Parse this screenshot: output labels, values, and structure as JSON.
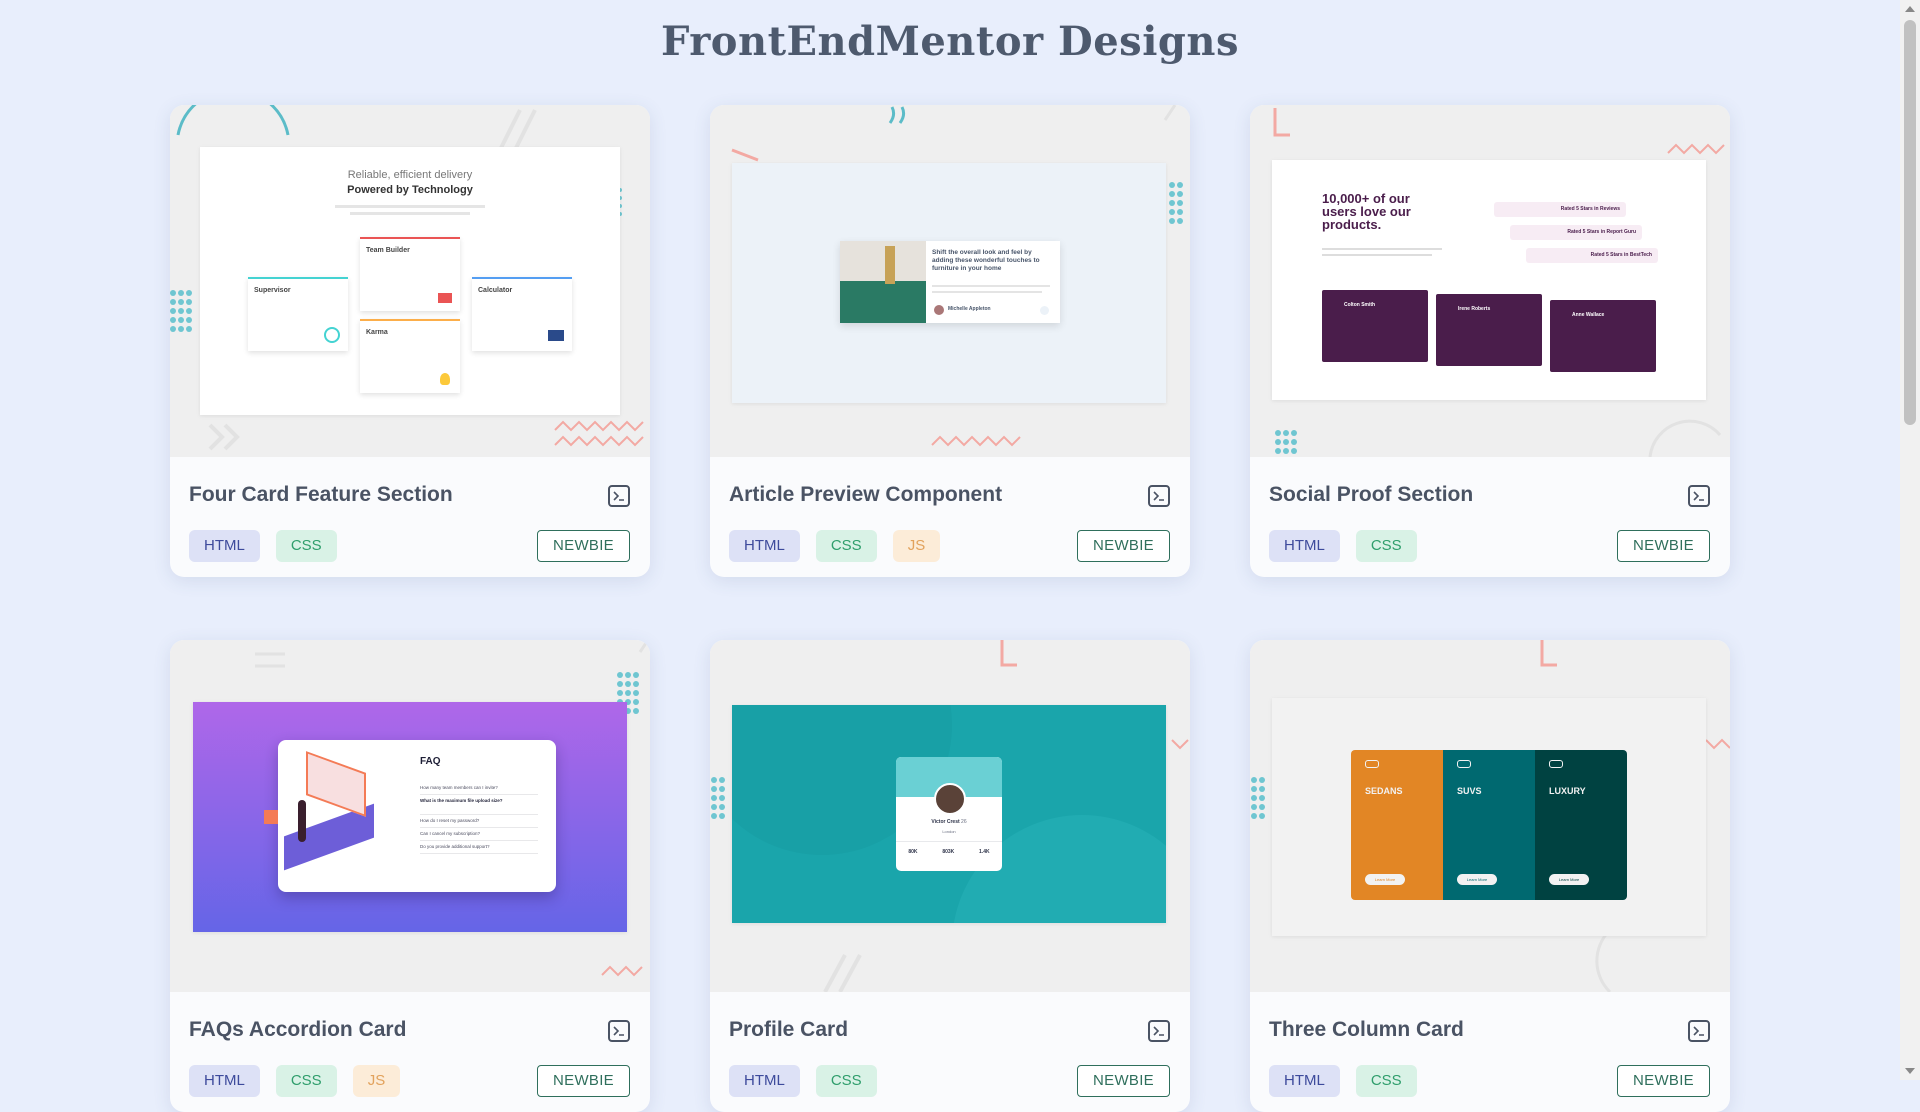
{
  "page": {
    "title": "FrontEndMentor Designs"
  },
  "colors": {
    "background": "#e8eefc",
    "html_tag": "#3d4a9c",
    "css_tag": "#2f9e6c",
    "js_tag": "#e2a25c",
    "level_border": "#2f6f5c"
  },
  "cards": [
    {
      "title": "Four Card Feature Section",
      "tags": [
        "HTML",
        "CSS"
      ],
      "level": "NEWBIE",
      "icon": "terminal-icon",
      "preview": {
        "heading_light": "Reliable, efficient delivery",
        "heading_bold": "Powered by Technology",
        "items": [
          "Supervisor",
          "Team Builder",
          "Karma",
          "Calculator"
        ]
      }
    },
    {
      "title": "Article Preview Component",
      "tags": [
        "HTML",
        "CSS",
        "JS"
      ],
      "level": "NEWBIE",
      "icon": "terminal-icon",
      "preview": {
        "headline": "Shift the overall look and feel by adding these wonderful touches to furniture in your home",
        "author": "Michelle Appleton"
      }
    },
    {
      "title": "Social Proof Section",
      "tags": [
        "HTML",
        "CSS"
      ],
      "level": "NEWBIE",
      "icon": "terminal-icon",
      "preview": {
        "headline": "10,000+ of our users love our products.",
        "ratings": [
          "Rated 5 Stars in Reviews",
          "Rated 5 Stars in Report Guru",
          "Rated 5 Stars in BestTech"
        ],
        "people": [
          "Colton Smith",
          "Irene Roberts",
          "Anne Wallace"
        ]
      }
    },
    {
      "title": "FAQs Accordion Card",
      "tags": [
        "HTML",
        "CSS",
        "JS"
      ],
      "level": "NEWBIE",
      "icon": "terminal-icon",
      "preview": {
        "heading": "FAQ",
        "questions": [
          "How many team members can I invite?",
          "What is the maximum file upload size?",
          "How do I reset my password?",
          "Can I cancel my subscription?",
          "Do you provide additional support?"
        ]
      }
    },
    {
      "title": "Profile Card",
      "tags": [
        "HTML",
        "CSS"
      ],
      "level": "NEWBIE",
      "icon": "terminal-icon",
      "preview": {
        "name": "Victor Crest",
        "age": "26",
        "city": "London",
        "stats": [
          "80K",
          "803K",
          "1.4K"
        ]
      }
    },
    {
      "title": "Three Column Card",
      "tags": [
        "HTML",
        "CSS"
      ],
      "level": "NEWBIE",
      "icon": "terminal-icon",
      "preview": {
        "columns": [
          "SEDANS",
          "SUVS",
          "LUXURY"
        ],
        "button": "Learn More"
      }
    }
  ]
}
